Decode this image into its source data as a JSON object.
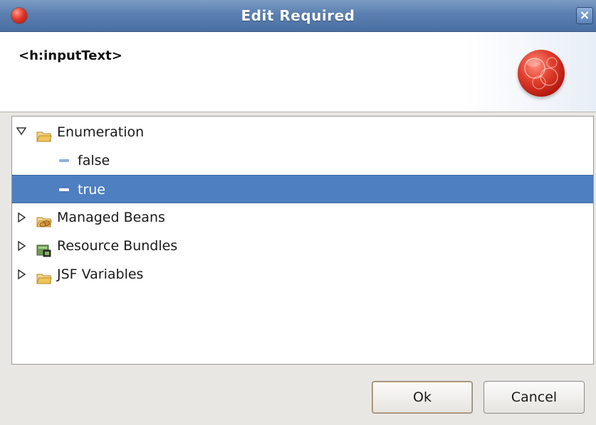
{
  "window": {
    "title": "Edit Required"
  },
  "header": {
    "tag_name": "<h:inputText>"
  },
  "tree": {
    "enumeration": {
      "label": "Enumeration",
      "children": [
        "false",
        "true"
      ],
      "selected": "true"
    },
    "managed_beans": {
      "label": "Managed Beans"
    },
    "resource_bundles": {
      "label": "Resource Bundles"
    },
    "jsf_variables": {
      "label": "JSF Variables"
    }
  },
  "buttons": {
    "ok_label": "Ok",
    "cancel_label": "Cancel"
  },
  "icons": {
    "app": "red-sphere-icon",
    "close": "close-icon",
    "expanded": "triangle-down-icon",
    "collapsed": "triangle-right-icon",
    "folder": "folder-icon",
    "beans": "beans-folder-icon",
    "bundles": "resource-bundle-icon",
    "leaf": "dash-icon"
  },
  "colors": {
    "titlebar": "#5a7fb0",
    "selection": "#4e7fc0",
    "folder": "#f0c45a"
  }
}
